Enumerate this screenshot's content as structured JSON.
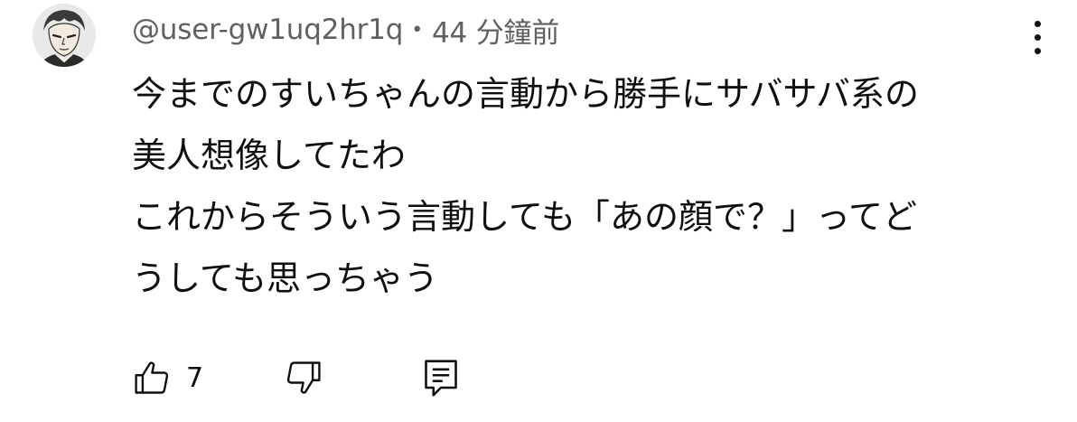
{
  "comment": {
    "author": "@user-gw1uq2hr1q",
    "separator": "•",
    "timestamp": "44 分鐘前",
    "lines": [
      "今までのすいちゃんの言動から勝手にサバサバ系の",
      "美人想像してたわ",
      "これからそういう言動しても「あの顔で？」ってど",
      "うしても思っちゃう"
    ],
    "like_count": "7"
  },
  "icons": {
    "avatar": "anime-character-avatar",
    "menu": "more-vert-icon",
    "like": "thumb-up-icon",
    "dislike": "thumb-down-icon",
    "reply": "reply-comment-icon"
  },
  "colors": {
    "text_primary": "#0f0f0f",
    "text_secondary": "#606060",
    "background": "#ffffff"
  }
}
